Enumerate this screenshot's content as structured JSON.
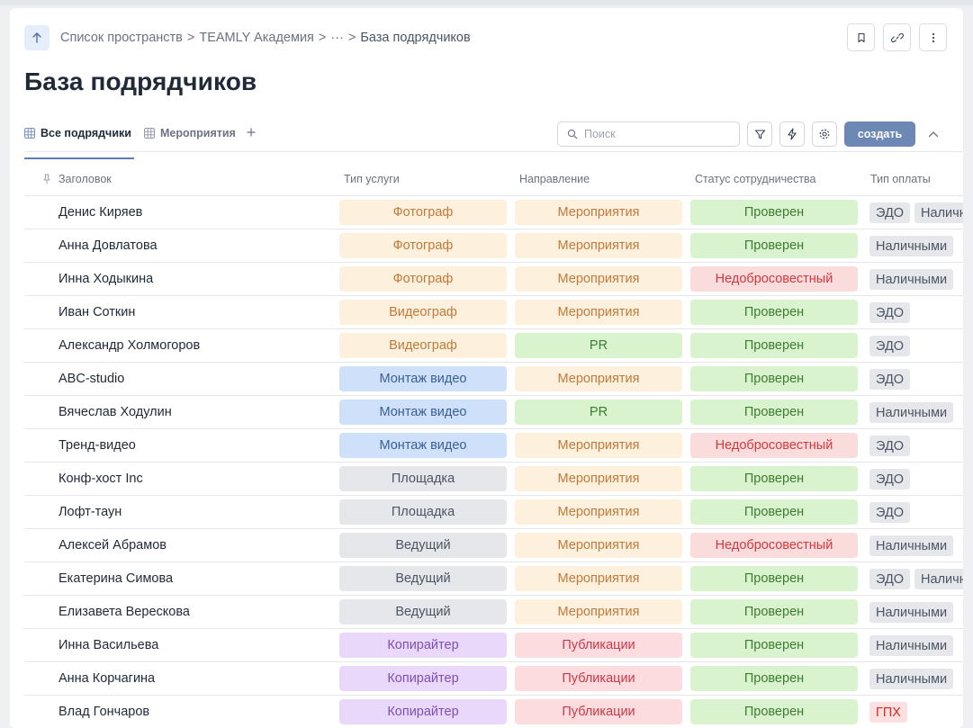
{
  "breadcrumb": {
    "items": [
      "Список пространств",
      "TEAMLY Академия",
      "···",
      "База подрядчиков"
    ],
    "separator": ">"
  },
  "page_title": "База подрядчиков",
  "tabs": [
    {
      "label": "Все подрядчики",
      "active": true
    },
    {
      "label": "Мероприятия",
      "active": false
    }
  ],
  "search": {
    "placeholder": "Поиск",
    "value": ""
  },
  "toolbar": {
    "create_label": "создать"
  },
  "icons": {
    "back": "arrow-up-icon",
    "bookmark": "bookmark-icon",
    "link": "link-icon",
    "more": "more-vertical-icon",
    "table": "table-grid-icon",
    "add_tab": "plus-icon",
    "search": "search-icon",
    "filter": "filter-icon",
    "automation": "lightning-icon",
    "settings": "gear-icon",
    "collapse": "chevron-up-icon",
    "pin": "pin-icon"
  },
  "colors": {
    "accent": "#6e88b6",
    "tag_orange": "#fdf0dd",
    "tag_blue": "#cfe0fb",
    "tag_gray": "#e5e7eb",
    "tag_purple": "#ead8fb",
    "tag_green": "#d9f3cf",
    "tag_red": "#fbdcdc"
  },
  "table": {
    "columns": [
      "Заголовок",
      "Тип услуги",
      "Направление",
      "Статус сотрудничества",
      "Тип оплаты"
    ],
    "rows": [
      {
        "name": "Денис Киряев",
        "service": "Фотограф",
        "service_color": "orange",
        "direction": "Мероприятия",
        "direction_color": "orange",
        "status": "Проверен",
        "status_color": "green",
        "payment": [
          "ЭДО",
          "Наличными"
        ]
      },
      {
        "name": "Анна Довлатова",
        "service": "Фотограф",
        "service_color": "orange",
        "direction": "Мероприятия",
        "direction_color": "orange",
        "status": "Проверен",
        "status_color": "green",
        "payment": [
          "Наличными"
        ]
      },
      {
        "name": "Инна Ходыкина",
        "service": "Фотограф",
        "service_color": "orange",
        "direction": "Мероприятия",
        "direction_color": "orange",
        "status": "Недобросовестный",
        "status_color": "red",
        "payment": [
          "Наличными"
        ]
      },
      {
        "name": "Иван Соткин",
        "service": "Видеограф",
        "service_color": "orange",
        "direction": "Мероприятия",
        "direction_color": "orange",
        "status": "Проверен",
        "status_color": "green",
        "payment": [
          "ЭДО"
        ]
      },
      {
        "name": "Александр Холмогоров",
        "service": "Видеограф",
        "service_color": "orange",
        "direction": "PR",
        "direction_color": "green",
        "status": "Проверен",
        "status_color": "green",
        "payment": [
          "ЭДО"
        ]
      },
      {
        "name": "ABC-studio",
        "service": "Монтаж видео",
        "service_color": "blue",
        "direction": "Мероприятия",
        "direction_color": "orange",
        "status": "Проверен",
        "status_color": "green",
        "payment": [
          "ЭДО"
        ]
      },
      {
        "name": "Вячеслав Ходулин",
        "service": "Монтаж видео",
        "service_color": "blue",
        "direction": "PR",
        "direction_color": "green",
        "status": "Проверен",
        "status_color": "green",
        "payment": [
          "Наличными"
        ]
      },
      {
        "name": "Тренд-видео",
        "service": "Монтаж видео",
        "service_color": "blue",
        "direction": "Мероприятия",
        "direction_color": "orange",
        "status": "Недобросовестный",
        "status_color": "red",
        "payment": [
          "ЭДО"
        ]
      },
      {
        "name": "Конф-хост Inc",
        "service": "Площадка",
        "service_color": "gray",
        "direction": "Мероприятия",
        "direction_color": "orange",
        "status": "Проверен",
        "status_color": "green",
        "payment": [
          "ЭДО"
        ]
      },
      {
        "name": "Лофт-таун",
        "service": "Площадка",
        "service_color": "gray",
        "direction": "Мероприятия",
        "direction_color": "orange",
        "status": "Проверен",
        "status_color": "green",
        "payment": [
          "ЭДО"
        ]
      },
      {
        "name": "Алексей Абрамов",
        "service": "Ведущий",
        "service_color": "gray",
        "direction": "Мероприятия",
        "direction_color": "orange",
        "status": "Недобросовестный",
        "status_color": "red",
        "payment": [
          "Наличными"
        ]
      },
      {
        "name": "Екатерина Симова",
        "service": "Ведущий",
        "service_color": "gray",
        "direction": "Мероприятия",
        "direction_color": "orange",
        "status": "Проверен",
        "status_color": "green",
        "payment": [
          "ЭДО",
          "Наличными"
        ]
      },
      {
        "name": "Елизавета Верескова",
        "service": "Ведущий",
        "service_color": "gray",
        "direction": "Мероприятия",
        "direction_color": "orange",
        "status": "Проверен",
        "status_color": "green",
        "payment": [
          "Наличными"
        ]
      },
      {
        "name": "Инна Васильева",
        "service": "Копирайтер",
        "service_color": "purple",
        "direction": "Публикации",
        "direction_color": "pink",
        "status": "Проверен",
        "status_color": "green",
        "payment": [
          "Наличными"
        ]
      },
      {
        "name": "Анна Корчагина",
        "service": "Копирайтер",
        "service_color": "purple",
        "direction": "Публикации",
        "direction_color": "pink",
        "status": "Проверен",
        "status_color": "green",
        "payment": [
          "Наличными"
        ]
      },
      {
        "name": "Влад Гончаров",
        "service": "Копирайтер",
        "service_color": "purple",
        "direction": "Публикации",
        "direction_color": "pink",
        "status": "Проверен",
        "status_color": "green",
        "payment": [
          "ГПХ"
        ]
      }
    ]
  }
}
